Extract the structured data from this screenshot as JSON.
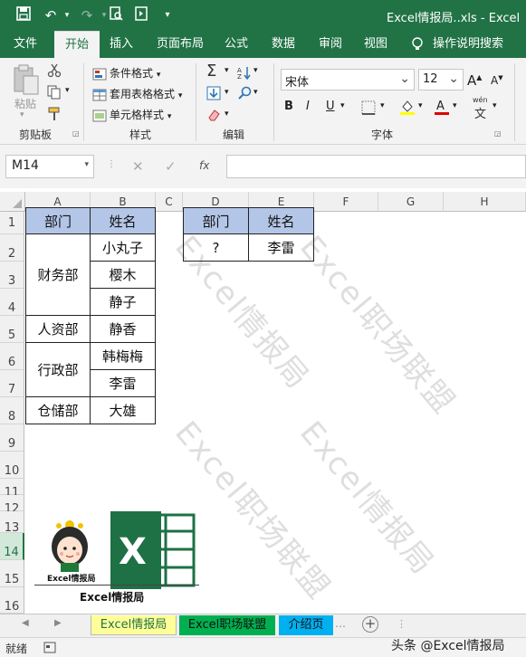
{
  "titlebar": {
    "title": "Excel情报局..xls  -  Excel"
  },
  "tabs": [
    "文件",
    "开始",
    "插入",
    "页面布局",
    "公式",
    "数据",
    "审阅",
    "视图"
  ],
  "tell_me": "操作说明搜索",
  "ribbon": {
    "paste": "粘贴",
    "clipboard": "剪贴板",
    "conditional_format": "条件格式",
    "table_format": "套用表格格式",
    "cell_style": "单元格样式",
    "styles": "样式",
    "editing": "编辑",
    "font_name": "宋体",
    "font_size": "12",
    "font_group": "字体",
    "bold": "B",
    "italic": "I",
    "underline": "U",
    "grow": "A",
    "shrink": "A",
    "wen": "wén",
    "wen_char": "文"
  },
  "formula": {
    "name_box": "M14",
    "fx": "fx",
    "value": ""
  },
  "columns": [
    "A",
    "B",
    "C",
    "D",
    "E",
    "F",
    "G",
    "H"
  ],
  "rows": [
    "1",
    "2",
    "3",
    "4",
    "5",
    "6",
    "7",
    "8",
    "9",
    "10",
    "11",
    "12",
    "13",
    "14",
    "15",
    "16"
  ],
  "table1": {
    "header": [
      "部门",
      "姓名"
    ],
    "depts": [
      "财务部",
      "人资部",
      "行政部",
      "仓储部"
    ],
    "names": [
      "小丸子",
      "樱木",
      "静子",
      "静香",
      "韩梅梅",
      "李雷",
      "大雄"
    ]
  },
  "table2": {
    "header": [
      "部门",
      "姓名"
    ],
    "dept": "?",
    "name": "李雷"
  },
  "watermarks": [
    "Excel情报局",
    "Excel职场联盟",
    "Excel职场联盟",
    "Excel情报局"
  ],
  "logo": {
    "caption_small": "Excel情报局",
    "caption": "Excel情报局"
  },
  "sheets": [
    "Excel情报局",
    "Excel职场联盟",
    "介绍页"
  ],
  "status": {
    "ready": "就绪",
    "brand": "头条 @Excel情报局"
  }
}
